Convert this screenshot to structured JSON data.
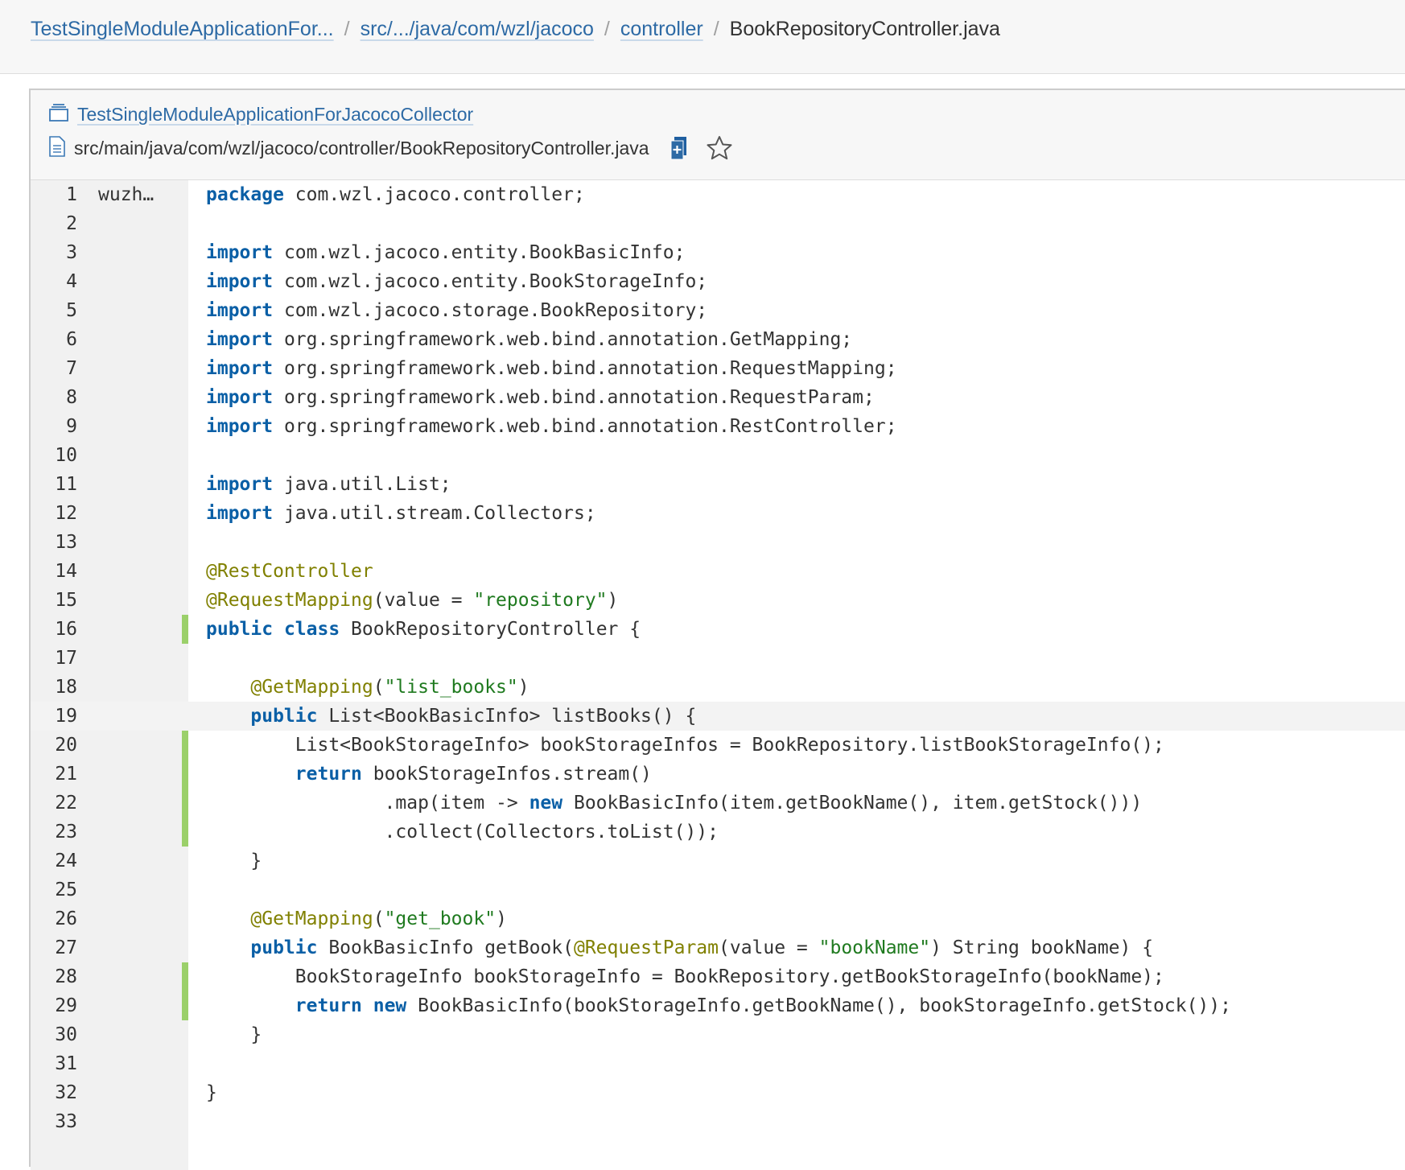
{
  "breadcrumb": {
    "project": "TestSingleModuleApplicationFor...",
    "path": "src/.../java/com/wzl/jacoco",
    "folder": "controller",
    "file": "BookRepositoryController.java",
    "separator": "/"
  },
  "header": {
    "project_name": "TestSingleModuleApplicationForJacocoCollector",
    "file_path": "src/main/java/com/wzl/jacoco/controller/BookRepositoryController.java",
    "icons": [
      "project-icon",
      "file-icon",
      "copy-path-icon",
      "star-icon"
    ]
  },
  "colors": {
    "link": "#2d6aa5",
    "keyword": "#0a5fa6",
    "annotation": "#808000",
    "string": "#1f7a1f",
    "coverage": "#9bd06a"
  },
  "code": {
    "lines": [
      {
        "n": "1",
        "blame": "wuzh…",
        "covered": false,
        "highlight": false,
        "tokens": [
          {
            "t": "kw",
            "v": "package"
          },
          {
            "t": "p",
            "v": " com.wzl.jacoco.controller;"
          }
        ]
      },
      {
        "n": "2",
        "blame": "",
        "covered": false,
        "highlight": false,
        "tokens": []
      },
      {
        "n": "3",
        "blame": "",
        "covered": false,
        "highlight": false,
        "tokens": [
          {
            "t": "kw",
            "v": "import"
          },
          {
            "t": "p",
            "v": " com.wzl.jacoco.entity.BookBasicInfo;"
          }
        ]
      },
      {
        "n": "4",
        "blame": "",
        "covered": false,
        "highlight": false,
        "tokens": [
          {
            "t": "kw",
            "v": "import"
          },
          {
            "t": "p",
            "v": " com.wzl.jacoco.entity.BookStorageInfo;"
          }
        ]
      },
      {
        "n": "5",
        "blame": "",
        "covered": false,
        "highlight": false,
        "tokens": [
          {
            "t": "kw",
            "v": "import"
          },
          {
            "t": "p",
            "v": " com.wzl.jacoco.storage.BookRepository;"
          }
        ]
      },
      {
        "n": "6",
        "blame": "",
        "covered": false,
        "highlight": false,
        "tokens": [
          {
            "t": "kw",
            "v": "import"
          },
          {
            "t": "p",
            "v": " org.springframework.web.bind.annotation.GetMapping;"
          }
        ]
      },
      {
        "n": "7",
        "blame": "",
        "covered": false,
        "highlight": false,
        "tokens": [
          {
            "t": "kw",
            "v": "import"
          },
          {
            "t": "p",
            "v": " org.springframework.web.bind.annotation.RequestMapping;"
          }
        ]
      },
      {
        "n": "8",
        "blame": "",
        "covered": false,
        "highlight": false,
        "tokens": [
          {
            "t": "kw",
            "v": "import"
          },
          {
            "t": "p",
            "v": " org.springframework.web.bind.annotation.RequestParam;"
          }
        ]
      },
      {
        "n": "9",
        "blame": "",
        "covered": false,
        "highlight": false,
        "tokens": [
          {
            "t": "kw",
            "v": "import"
          },
          {
            "t": "p",
            "v": " org.springframework.web.bind.annotation.RestController;"
          }
        ]
      },
      {
        "n": "10",
        "blame": "",
        "covered": false,
        "highlight": false,
        "tokens": []
      },
      {
        "n": "11",
        "blame": "",
        "covered": false,
        "highlight": false,
        "tokens": [
          {
            "t": "kw",
            "v": "import"
          },
          {
            "t": "p",
            "v": " java.util.List;"
          }
        ]
      },
      {
        "n": "12",
        "blame": "",
        "covered": false,
        "highlight": false,
        "tokens": [
          {
            "t": "kw",
            "v": "import"
          },
          {
            "t": "p",
            "v": " java.util.stream.Collectors;"
          }
        ]
      },
      {
        "n": "13",
        "blame": "",
        "covered": false,
        "highlight": false,
        "tokens": []
      },
      {
        "n": "14",
        "blame": "",
        "covered": false,
        "highlight": false,
        "tokens": [
          {
            "t": "an",
            "v": "@RestController"
          }
        ]
      },
      {
        "n": "15",
        "blame": "",
        "covered": false,
        "highlight": false,
        "tokens": [
          {
            "t": "an",
            "v": "@RequestMapping"
          },
          {
            "t": "p",
            "v": "(value = "
          },
          {
            "t": "st",
            "v": "\"repository\""
          },
          {
            "t": "p",
            "v": ")"
          }
        ]
      },
      {
        "n": "16",
        "blame": "",
        "covered": true,
        "highlight": false,
        "tokens": [
          {
            "t": "kw",
            "v": "public"
          },
          {
            "t": "p",
            "v": " "
          },
          {
            "t": "kw",
            "v": "class"
          },
          {
            "t": "p",
            "v": " BookRepositoryController {"
          }
        ]
      },
      {
        "n": "17",
        "blame": "",
        "covered": false,
        "highlight": false,
        "tokens": []
      },
      {
        "n": "18",
        "blame": "",
        "covered": false,
        "highlight": false,
        "tokens": [
          {
            "t": "p",
            "v": "    "
          },
          {
            "t": "an",
            "v": "@GetMapping"
          },
          {
            "t": "p",
            "v": "("
          },
          {
            "t": "st",
            "v": "\"list_books\""
          },
          {
            "t": "p",
            "v": ")"
          }
        ]
      },
      {
        "n": "19",
        "blame": "",
        "covered": false,
        "highlight": true,
        "tokens": [
          {
            "t": "p",
            "v": "    "
          },
          {
            "t": "kw",
            "v": "public"
          },
          {
            "t": "p",
            "v": " List<BookBasicInfo> listBooks() {"
          }
        ]
      },
      {
        "n": "20",
        "blame": "",
        "covered": true,
        "highlight": false,
        "tokens": [
          {
            "t": "p",
            "v": "        List<BookStorageInfo> bookStorageInfos = BookRepository.listBookStorageInfo();"
          }
        ]
      },
      {
        "n": "21",
        "blame": "",
        "covered": true,
        "highlight": false,
        "tokens": [
          {
            "t": "p",
            "v": "        "
          },
          {
            "t": "kw",
            "v": "return"
          },
          {
            "t": "p",
            "v": " bookStorageInfos.stream()"
          }
        ]
      },
      {
        "n": "22",
        "blame": "",
        "covered": true,
        "highlight": false,
        "tokens": [
          {
            "t": "p",
            "v": "                .map(item -> "
          },
          {
            "t": "kw",
            "v": "new"
          },
          {
            "t": "p",
            "v": " BookBasicInfo(item.getBookName(), item.getStock()))"
          }
        ]
      },
      {
        "n": "23",
        "blame": "",
        "covered": true,
        "highlight": false,
        "tokens": [
          {
            "t": "p",
            "v": "                .collect(Collectors.toList());"
          }
        ]
      },
      {
        "n": "24",
        "blame": "",
        "covered": false,
        "highlight": false,
        "tokens": [
          {
            "t": "p",
            "v": "    }"
          }
        ]
      },
      {
        "n": "25",
        "blame": "",
        "covered": false,
        "highlight": false,
        "tokens": []
      },
      {
        "n": "26",
        "blame": "",
        "covered": false,
        "highlight": false,
        "tokens": [
          {
            "t": "p",
            "v": "    "
          },
          {
            "t": "an",
            "v": "@GetMapping"
          },
          {
            "t": "p",
            "v": "("
          },
          {
            "t": "st",
            "v": "\"get_book\""
          },
          {
            "t": "p",
            "v": ")"
          }
        ]
      },
      {
        "n": "27",
        "blame": "",
        "covered": false,
        "highlight": false,
        "tokens": [
          {
            "t": "p",
            "v": "    "
          },
          {
            "t": "kw",
            "v": "public"
          },
          {
            "t": "p",
            "v": " BookBasicInfo getBook("
          },
          {
            "t": "an",
            "v": "@RequestParam"
          },
          {
            "t": "p",
            "v": "(value = "
          },
          {
            "t": "st",
            "v": "\"bookName\""
          },
          {
            "t": "p",
            "v": ") String bookName) {"
          }
        ]
      },
      {
        "n": "28",
        "blame": "",
        "covered": true,
        "highlight": false,
        "tokens": [
          {
            "t": "p",
            "v": "        BookStorageInfo bookStorageInfo = BookRepository.getBookStorageInfo(bookName);"
          }
        ]
      },
      {
        "n": "29",
        "blame": "",
        "covered": true,
        "highlight": false,
        "tokens": [
          {
            "t": "p",
            "v": "        "
          },
          {
            "t": "kw",
            "v": "return"
          },
          {
            "t": "p",
            "v": " "
          },
          {
            "t": "kw",
            "v": "new"
          },
          {
            "t": "p",
            "v": " BookBasicInfo(bookStorageInfo.getBookName(), bookStorageInfo.getStock());"
          }
        ]
      },
      {
        "n": "30",
        "blame": "",
        "covered": false,
        "highlight": false,
        "tokens": [
          {
            "t": "p",
            "v": "    }"
          }
        ]
      },
      {
        "n": "31",
        "blame": "",
        "covered": false,
        "highlight": false,
        "tokens": []
      },
      {
        "n": "32",
        "blame": "",
        "covered": false,
        "highlight": false,
        "tokens": [
          {
            "t": "p",
            "v": "}"
          }
        ]
      },
      {
        "n": "33",
        "blame": "",
        "covered": false,
        "highlight": false,
        "tokens": []
      }
    ]
  }
}
